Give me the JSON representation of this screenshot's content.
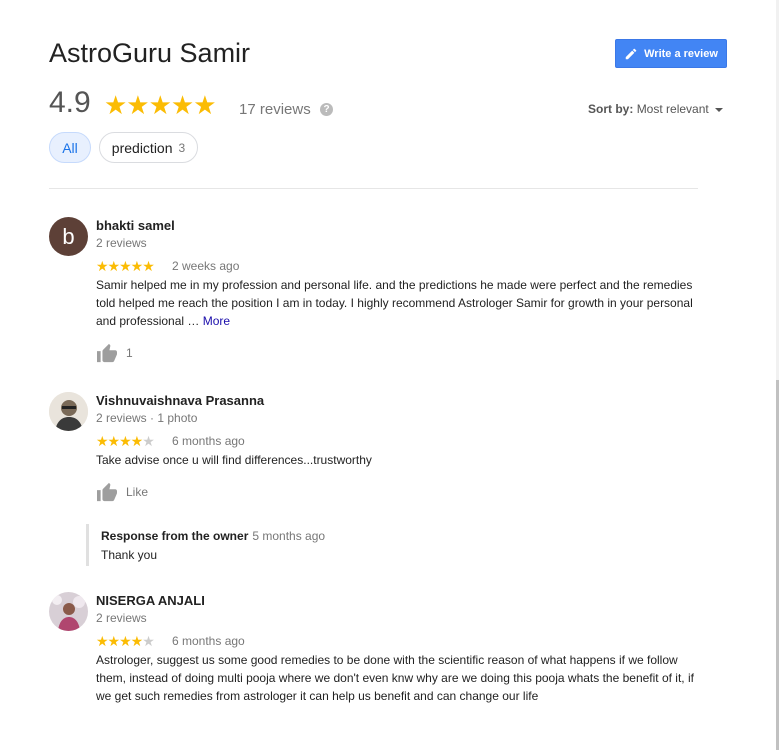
{
  "header": {
    "title": "AstroGuru Samir",
    "write_review_label": "Write a review",
    "rating": "4.9",
    "stars": "★★★★★",
    "review_count": "17 reviews",
    "help_symbol": "?",
    "sort_label": "Sort by:",
    "sort_value": "Most relevant"
  },
  "filters": {
    "all": "All",
    "prediction": "prediction",
    "prediction_count": "3"
  },
  "reviews": [
    {
      "avatar_letter": "b",
      "name": "bhakti samel",
      "meta": "2 reviews",
      "rating": 5,
      "stars_on": "★★★★★",
      "stars_off": "",
      "time": "2 weeks ago",
      "text": "Samir helped me in my profession and personal life. and the predictions he made were perfect and the remedies told helped me reach the position I am in today. I highly recommend Astrologer Samir for growth in your personal and professional … ",
      "more": "More",
      "likes": "1"
    },
    {
      "name": "Vishnuvaishnava Prasanna",
      "meta": "2 reviews · 1 photo",
      "rating": 4,
      "stars_on": "★★★★",
      "stars_off": "★",
      "time": "6 months ago",
      "text": "Take advise once u will find differences...trustworthy",
      "like_label": "Like",
      "owner_response": {
        "title": "Response from the owner",
        "time": "5 months ago",
        "text": "Thank you"
      }
    },
    {
      "name": "NISERGA ANJALI",
      "meta": "2 reviews",
      "rating": 4,
      "stars_on": "★★★★",
      "stars_off": "★",
      "time": "6 months ago",
      "text": "Astrologer, suggest us some good remedies to be done with the scientific reason of what happens if we follow them, instead of doing multi pooja where we don't even knw why are we doing this pooja whats the benefit of it, if we get such remedies from astrologer it can help us benefit and can change our life"
    }
  ],
  "colors": {
    "star": "#fbbc04",
    "accent": "#4285f4",
    "link": "#1a0dab"
  }
}
